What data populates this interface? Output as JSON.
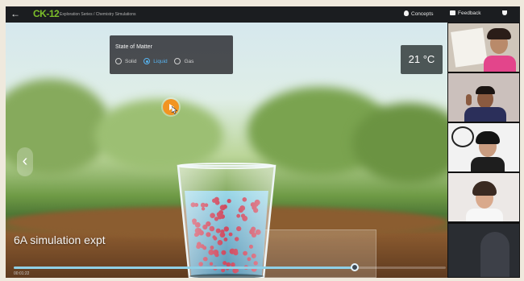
{
  "topbar": {
    "back_icon": "arrow-left-icon",
    "logo": "CK-12",
    "breadcrumb": "Exploration Series / Chemistry Simulations",
    "concepts": "Concepts",
    "feedback": "Feedback"
  },
  "simulation": {
    "panel_title": "State of Matter",
    "states": [
      {
        "label": "Solid",
        "selected": false
      },
      {
        "label": "Liquid",
        "selected": true
      },
      {
        "label": "Gas",
        "selected": false
      }
    ],
    "temperature": "21 °C",
    "caption": "6A simulation  expt",
    "time": "00:01:22",
    "seek_progress": 0.79
  },
  "participants": [
    {
      "name": "participant-1",
      "bg": "#cfc6ba"
    },
    {
      "name": "participant-2",
      "bg": "#cbc0bc"
    },
    {
      "name": "participant-3",
      "bg": "#f2f2f2"
    },
    {
      "name": "participant-4",
      "bg": "#ece8e6"
    },
    {
      "name": "participant-5",
      "bg": "#2a2d32"
    }
  ],
  "colors": {
    "accent": "#58b4f0",
    "play": "#f29422",
    "liquid": "#7ac6e8",
    "particles": "#c8324a"
  }
}
